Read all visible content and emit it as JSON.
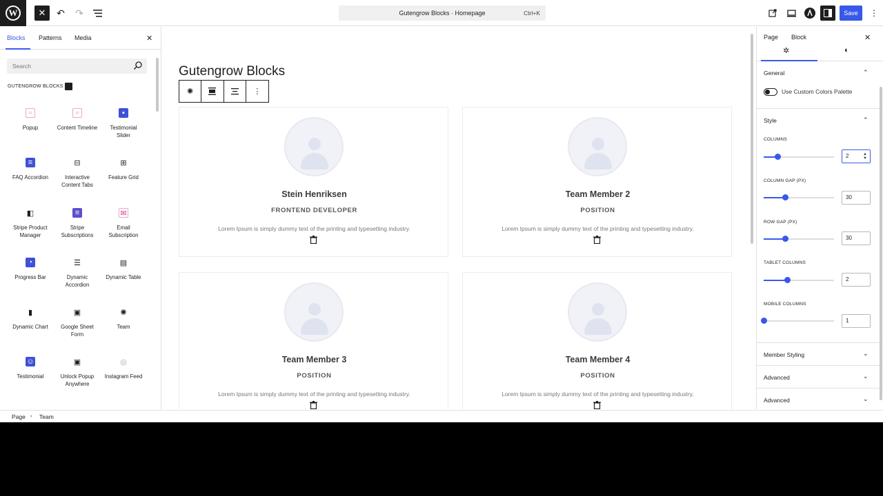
{
  "topbar": {
    "doc_title": "Gutengrow Blocks · Homepage",
    "shortcut": "Ctrl+K",
    "save_label": "Save"
  },
  "left_panel": {
    "tabs": [
      "Blocks",
      "Patterns",
      "Media"
    ],
    "active_tab": "Blocks",
    "search_placeholder": "Search",
    "category": "GUTENGROW BLOCKS",
    "blocks": [
      {
        "label": "Popup",
        "icon": "popup-icon"
      },
      {
        "label": "Content Timeline",
        "icon": "timeline-icon"
      },
      {
        "label": "Testimonial Slider",
        "icon": "testimonial-slider-icon"
      },
      {
        "label": "FAQ Accordion",
        "icon": "faq-icon"
      },
      {
        "label": "Interactive Content Tabs",
        "icon": "tabs-icon"
      },
      {
        "label": "Feature Grid",
        "icon": "grid-icon"
      },
      {
        "label": "Stripe Product Manager",
        "icon": "stripe-product-icon"
      },
      {
        "label": "Stripe Subscriptions",
        "icon": "stripe-subscriptions-icon"
      },
      {
        "label": "Email Subscription",
        "icon": "email-icon"
      },
      {
        "label": "Progress Bar",
        "icon": "progress-bar-icon"
      },
      {
        "label": "Dynamic Accordion",
        "icon": "list-icon"
      },
      {
        "label": "Dynamic Table",
        "icon": "table-icon"
      },
      {
        "label": "Dynamic Chart",
        "icon": "chart-icon"
      },
      {
        "label": "Google Sheet Form",
        "icon": "sheet-icon"
      },
      {
        "label": "Team",
        "icon": "team-icon"
      },
      {
        "label": "Testimonial",
        "icon": "testimonial-icon"
      },
      {
        "label": "Unlock Popup Anywhere",
        "icon": "unlock-icon"
      },
      {
        "label": "Instagram Feed",
        "icon": "instagram-icon"
      }
    ]
  },
  "canvas": {
    "page_title": "Gutengrow Blocks",
    "cards": [
      {
        "name": "Stein Henriksen",
        "position": "FRONTEND DEVELOPER",
        "description": "Lorem Ipsum is simply dummy text of the printing and typesetting industry."
      },
      {
        "name": "Team Member 2",
        "position": "POSITION",
        "description": "Lorem Ipsum is simply dummy text of the printing and typesetting industry."
      },
      {
        "name": "Team Member 3",
        "position": "POSITION",
        "description": "Lorem Ipsum is simply dummy text of the printing and typesetting industry."
      },
      {
        "name": "Team Member 4",
        "position": "POSITION",
        "description": "Lorem Ipsum is simply dummy text of the printing and typesetting industry."
      }
    ]
  },
  "right_panel": {
    "tabs": [
      "Page",
      "Block"
    ],
    "active_tab": "Block",
    "general_label": "General",
    "toggle_label": "Use Custom Colors Palette",
    "toggle_on": false,
    "style_label": "Style",
    "sliders": [
      {
        "label": "COLUMNS",
        "value": "2",
        "fraction": 0.2
      },
      {
        "label": "COLUMN GAP (PX)",
        "value": "30",
        "fraction": 0.3
      },
      {
        "label": "ROW GAP (PX)",
        "value": "30",
        "fraction": 0.3
      },
      {
        "label": "TABLET COLUMNS",
        "value": "2",
        "fraction": 0.33
      },
      {
        "label": "MOBILE COLUMNS",
        "value": "1",
        "fraction": 0.0
      }
    ],
    "sections": [
      "Member Styling",
      "Advanced",
      "Advanced"
    ]
  },
  "footer": {
    "breadcrumb": [
      "Page",
      "Team"
    ]
  },
  "colors": {
    "accent": "#3858e9",
    "dark": "#1e1e1e"
  }
}
